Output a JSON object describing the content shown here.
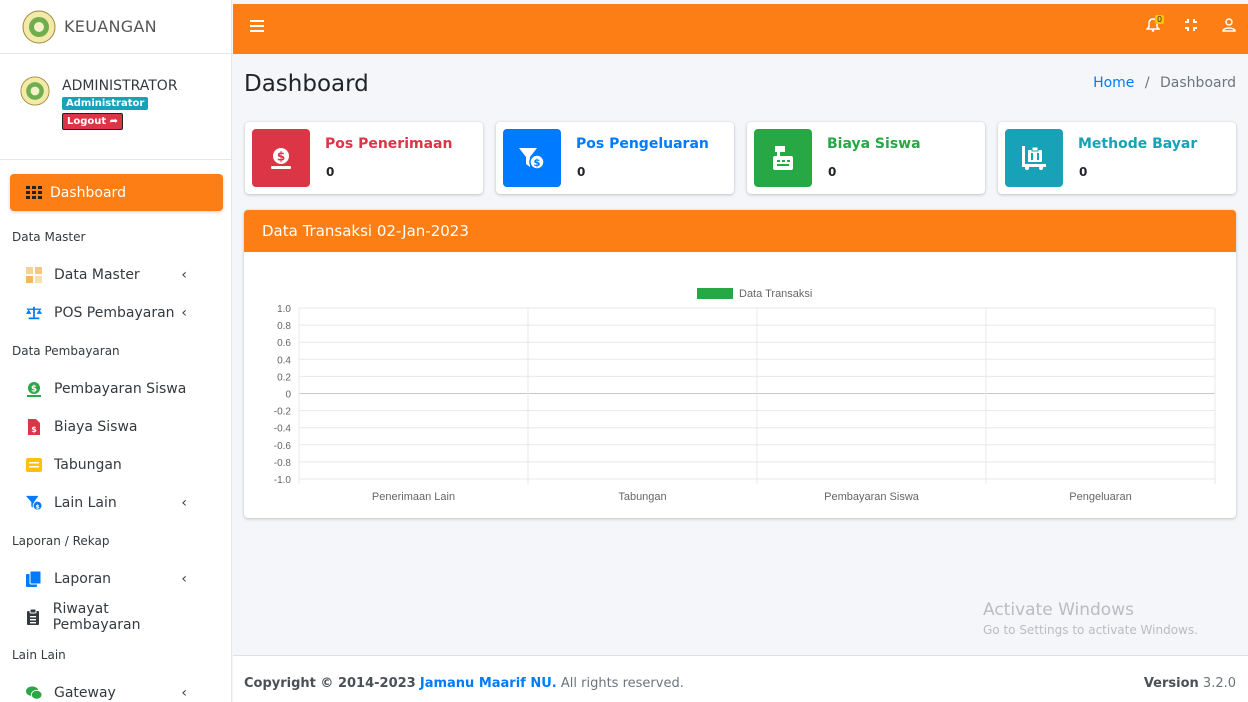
{
  "brand": {
    "name": "KEUANGAN"
  },
  "user": {
    "name": "ADMINISTRATOR",
    "role": "Administrator",
    "logout": "Logout"
  },
  "nav": {
    "active": "Dashboard",
    "sections": [
      {
        "header": "Data Master",
        "items": [
          {
            "label": "Data Master",
            "icon": "grid-icon",
            "has_children": true
          },
          {
            "label": "POS Pembayaran",
            "icon": "balance-scale-icon",
            "has_children": true
          }
        ]
      },
      {
        "header": "Data Pembayaran",
        "items": [
          {
            "label": "Pembayaran Siswa",
            "icon": "dollar-coin-icon",
            "has_children": false
          },
          {
            "label": "Biaya Siswa",
            "icon": "file-invoice-icon",
            "has_children": false
          },
          {
            "label": "Tabungan",
            "icon": "book-icon",
            "has_children": false
          },
          {
            "label": "Lain Lain",
            "icon": "funnel-dollar-icon",
            "has_children": true
          }
        ]
      },
      {
        "header": "Laporan / Rekap",
        "items": [
          {
            "label": "Laporan",
            "icon": "copy-icon",
            "has_children": true
          },
          {
            "label": "Riwayat Pembayaran",
            "icon": "clipboard-list-icon",
            "has_children": false
          }
        ]
      },
      {
        "header": "Lain Lain",
        "items": [
          {
            "label": "Gateway",
            "icon": "chat-icon",
            "has_children": true
          }
        ]
      }
    ]
  },
  "topbar": {
    "notification_count": "0"
  },
  "page": {
    "title": "Dashboard",
    "breadcrumb_home": "Home",
    "breadcrumb_sep": "/",
    "breadcrumb_current": "Dashboard"
  },
  "info_boxes": [
    {
      "label": "Pos Penerimaan",
      "value": "0",
      "color": "#dc3545",
      "icon": "hand-dollar-icon"
    },
    {
      "label": "Pos Pengeluaran",
      "value": "0",
      "color": "#007bff",
      "icon": "funnel-dollar-icon"
    },
    {
      "label": "Biaya Siswa",
      "value": "0",
      "color": "#28a745",
      "icon": "cash-register-icon"
    },
    {
      "label": "Methode Bayar",
      "value": "0",
      "color": "#17a2b8",
      "icon": "dolly-icon"
    }
  ],
  "chart_card": {
    "title": "Data Transaksi 02-Jan-2023"
  },
  "chart_data": {
    "type": "bar",
    "categories": [
      "Penerimaan Lain",
      "Tabungan",
      "Pembayaran Siswa",
      "Pengeluaran"
    ],
    "series": [
      {
        "name": "Data Transaksi",
        "values": [
          0,
          0,
          0,
          0
        ],
        "color": "#28a745"
      }
    ],
    "ylim": [
      -1.0,
      1.0
    ],
    "yticks": [
      "1.0",
      "0.8",
      "0.6",
      "0.4",
      "0.2",
      "0",
      "-0.2",
      "-0.4",
      "-0.6",
      "-0.8",
      "-1.0"
    ],
    "legend": "top-center",
    "grid": true
  },
  "watermark": {
    "line1": "Activate Windows",
    "line2": "Go to Settings to activate Windows."
  },
  "footer": {
    "copyright_prefix": "Copyright © 2014-2023",
    "org": "Jamanu Maarif NU.",
    "rights": "All rights reserved.",
    "version_label": "Version",
    "version": "3.2.0"
  },
  "colors": {
    "accent": "#fd7e14",
    "primary": "#007bff"
  }
}
